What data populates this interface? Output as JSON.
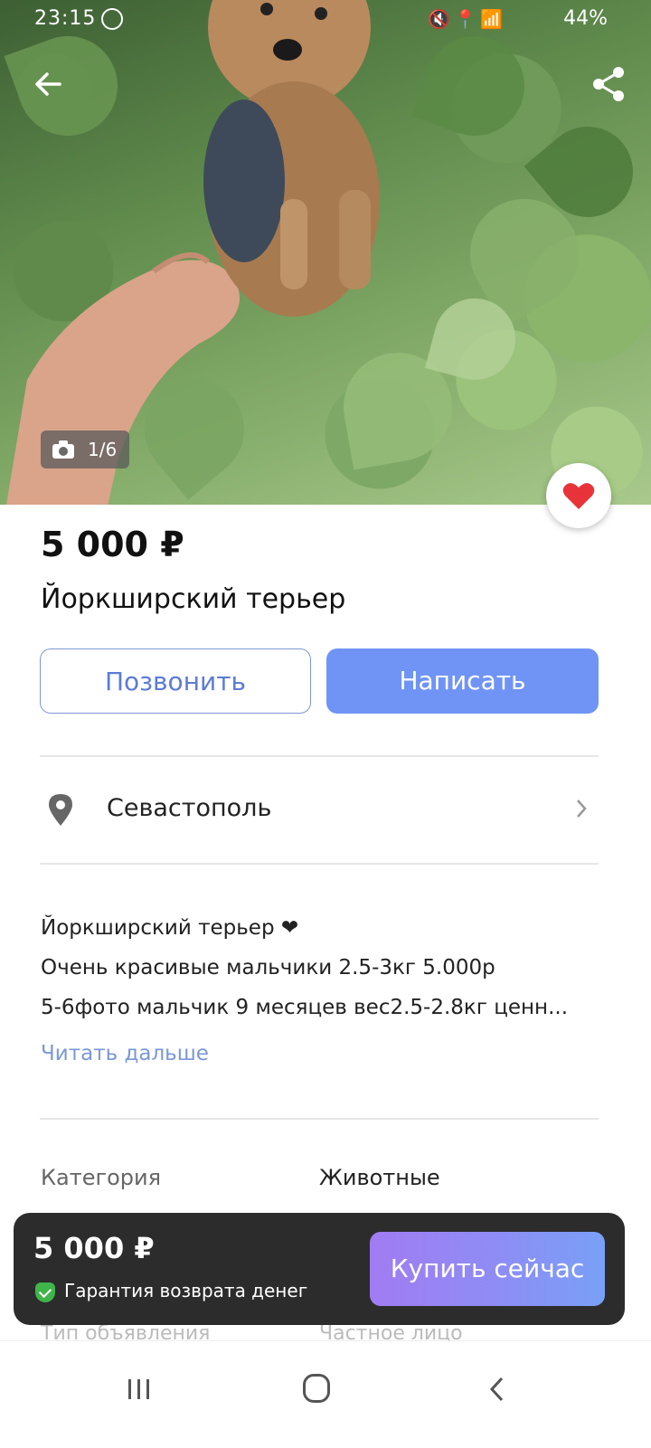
{
  "status_bar": {
    "time": "23:15",
    "battery": "44%"
  },
  "photo": {
    "counter": "1/6"
  },
  "listing": {
    "price": "5 000 ₽",
    "title": "Йоркширский терьер"
  },
  "actions": {
    "call_label": "Позвонить",
    "write_label": "Написать"
  },
  "location": {
    "city": "Севастополь"
  },
  "description": {
    "line1": "Йоркширский терьер ❤",
    "line2": "Очень красивые мальчики 2.5-3кг 5.000р",
    "line3": "5-6фото мальчик 9 месяцев вес2.5-2.8кг ценн...",
    "read_more": "Читать дальше"
  },
  "properties": [
    {
      "label": "Категория",
      "value": "Животные"
    },
    {
      "label": "Тип объявления",
      "value": "Частное лицо"
    }
  ],
  "buy_panel": {
    "price": "5 000 ₽",
    "guarantee": "Гарантия возврата денег",
    "buy_label": "Купить сейчас"
  },
  "colors": {
    "accent_blue": "#6f94f5",
    "favorite_red": "#e8333a",
    "panel_dark": "#2c2c2c"
  }
}
